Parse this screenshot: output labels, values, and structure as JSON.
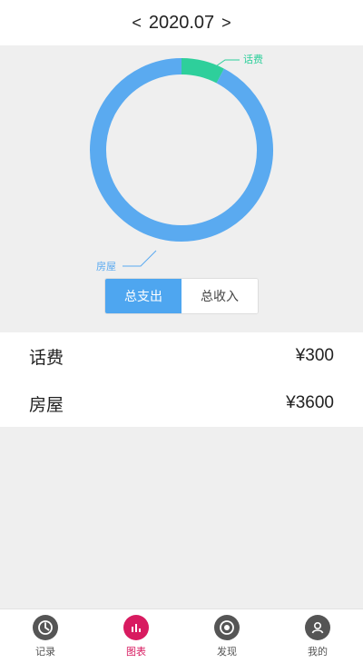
{
  "header": {
    "prev": "<",
    "month": "2020.07",
    "next": ">"
  },
  "chart": {
    "labels": {
      "top": "话费",
      "bottom": "房屋"
    },
    "segments": [
      {
        "name": "话费",
        "value": 300,
        "color": "#2ecf9b"
      },
      {
        "name": "房屋",
        "value": 3600,
        "color": "#5aaaf0"
      }
    ]
  },
  "toggle": {
    "expense": "总支出",
    "income": "总收入"
  },
  "list": [
    {
      "name": "话费",
      "amount": "¥300"
    },
    {
      "name": "房屋",
      "amount": "¥3600"
    }
  ],
  "tabs": [
    {
      "label": "记录",
      "icon": "clock-icon",
      "color": "#555555"
    },
    {
      "label": "图表",
      "icon": "chart-icon",
      "color": "#d81b60"
    },
    {
      "label": "发现",
      "icon": "compass-icon",
      "color": "#555555"
    },
    {
      "label": "我的",
      "icon": "user-icon",
      "color": "#555555"
    }
  ],
  "colors": {
    "accent": "#4ea6f0",
    "tab_active": "#d81b60"
  }
}
